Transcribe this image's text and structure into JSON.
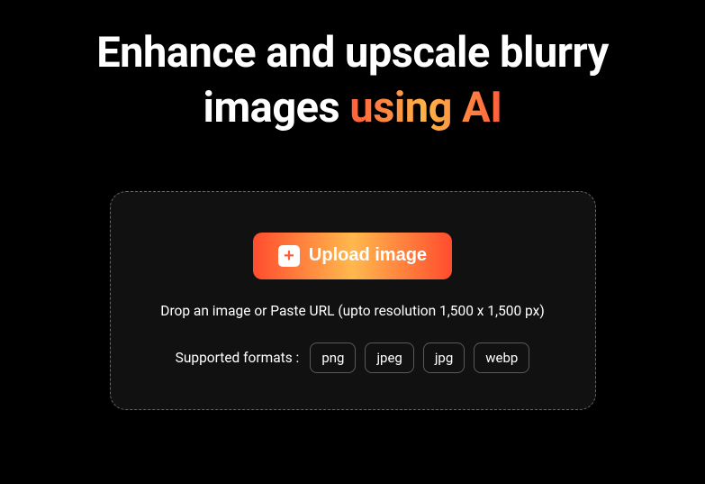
{
  "heading": {
    "line1": "Enhance and upscale blurry",
    "line2_part1": "images ",
    "line2_accent": "using AI"
  },
  "upload": {
    "button_label": "Upload image",
    "drop_hint": "Drop an image or Paste URL (upto resolution 1,500 x 1,500 px)",
    "formats_label": "Supported formats :",
    "formats": [
      "png",
      "jpeg",
      "jpg",
      "webp"
    ]
  }
}
